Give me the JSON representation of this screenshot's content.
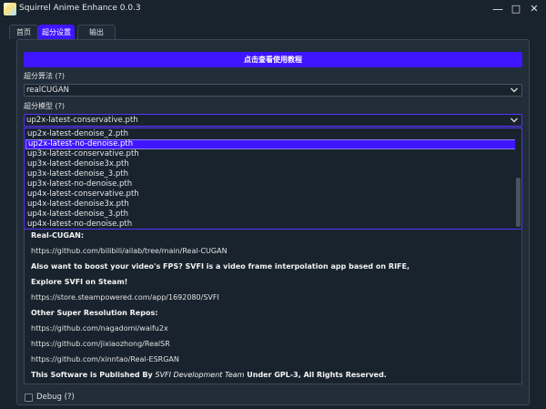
{
  "window": {
    "title": "Squirrel Anime Enhance 0.0.3",
    "minimize": "—",
    "maximize": "□",
    "close": "✕"
  },
  "tabs": [
    {
      "label": "首页"
    },
    {
      "label": "超分设置"
    },
    {
      "label": "输出"
    }
  ],
  "tutorial_button": "点击查看使用教程",
  "algorithm": {
    "label": "超分算法 (?)",
    "value": "realCUGAN"
  },
  "model": {
    "label": "超分模型 (?)",
    "value": "up2x-latest-conservative.pth",
    "options": [
      "up2x-latest-denoise_2.pth",
      "up2x-latest-no-denoise.pth",
      "up3x-latest-conservative.pth",
      "up3x-latest-denoise3x.pth",
      "up3x-latest-denoise_3.pth",
      "up3x-latest-no-denoise.pth",
      "up4x-latest-conservative.pth",
      "up4x-latest-denoise3x.pth",
      "up4x-latest-denoise_3.pth",
      "up4x-latest-no-denoise.pth"
    ],
    "selected_index": 1
  },
  "doc": {
    "realcugan_heading": "Real-CUGAN:",
    "realcugan_url": "https://github.com/bilibili/ailab/tree/main/Real-CUGAN",
    "svfi_promo": "Also want to boost your video's FPS? SVFI is a video frame interpolation app based on RIFE,",
    "svfi_explore": "Explore SVFI on Steam!",
    "steam_url": "https://store.steampowered.com/app/1692080/SVFI",
    "other_heading": "Other Super Resolution Repos:",
    "repo_waifu": "https://github.com/nagadomi/waifu2x",
    "repo_realsr": "https://github.com/jixiaozhong/RealSR",
    "repo_esrgan": "https://github.com/xinntao/Real-ESRGAN",
    "published_pre": "This Software is Published By ",
    "published_team": "SVFI Development Team",
    "published_post": " Under GPL-3, All Rights Reserved."
  },
  "debug": {
    "label": "Debug (?)",
    "checked": false
  }
}
